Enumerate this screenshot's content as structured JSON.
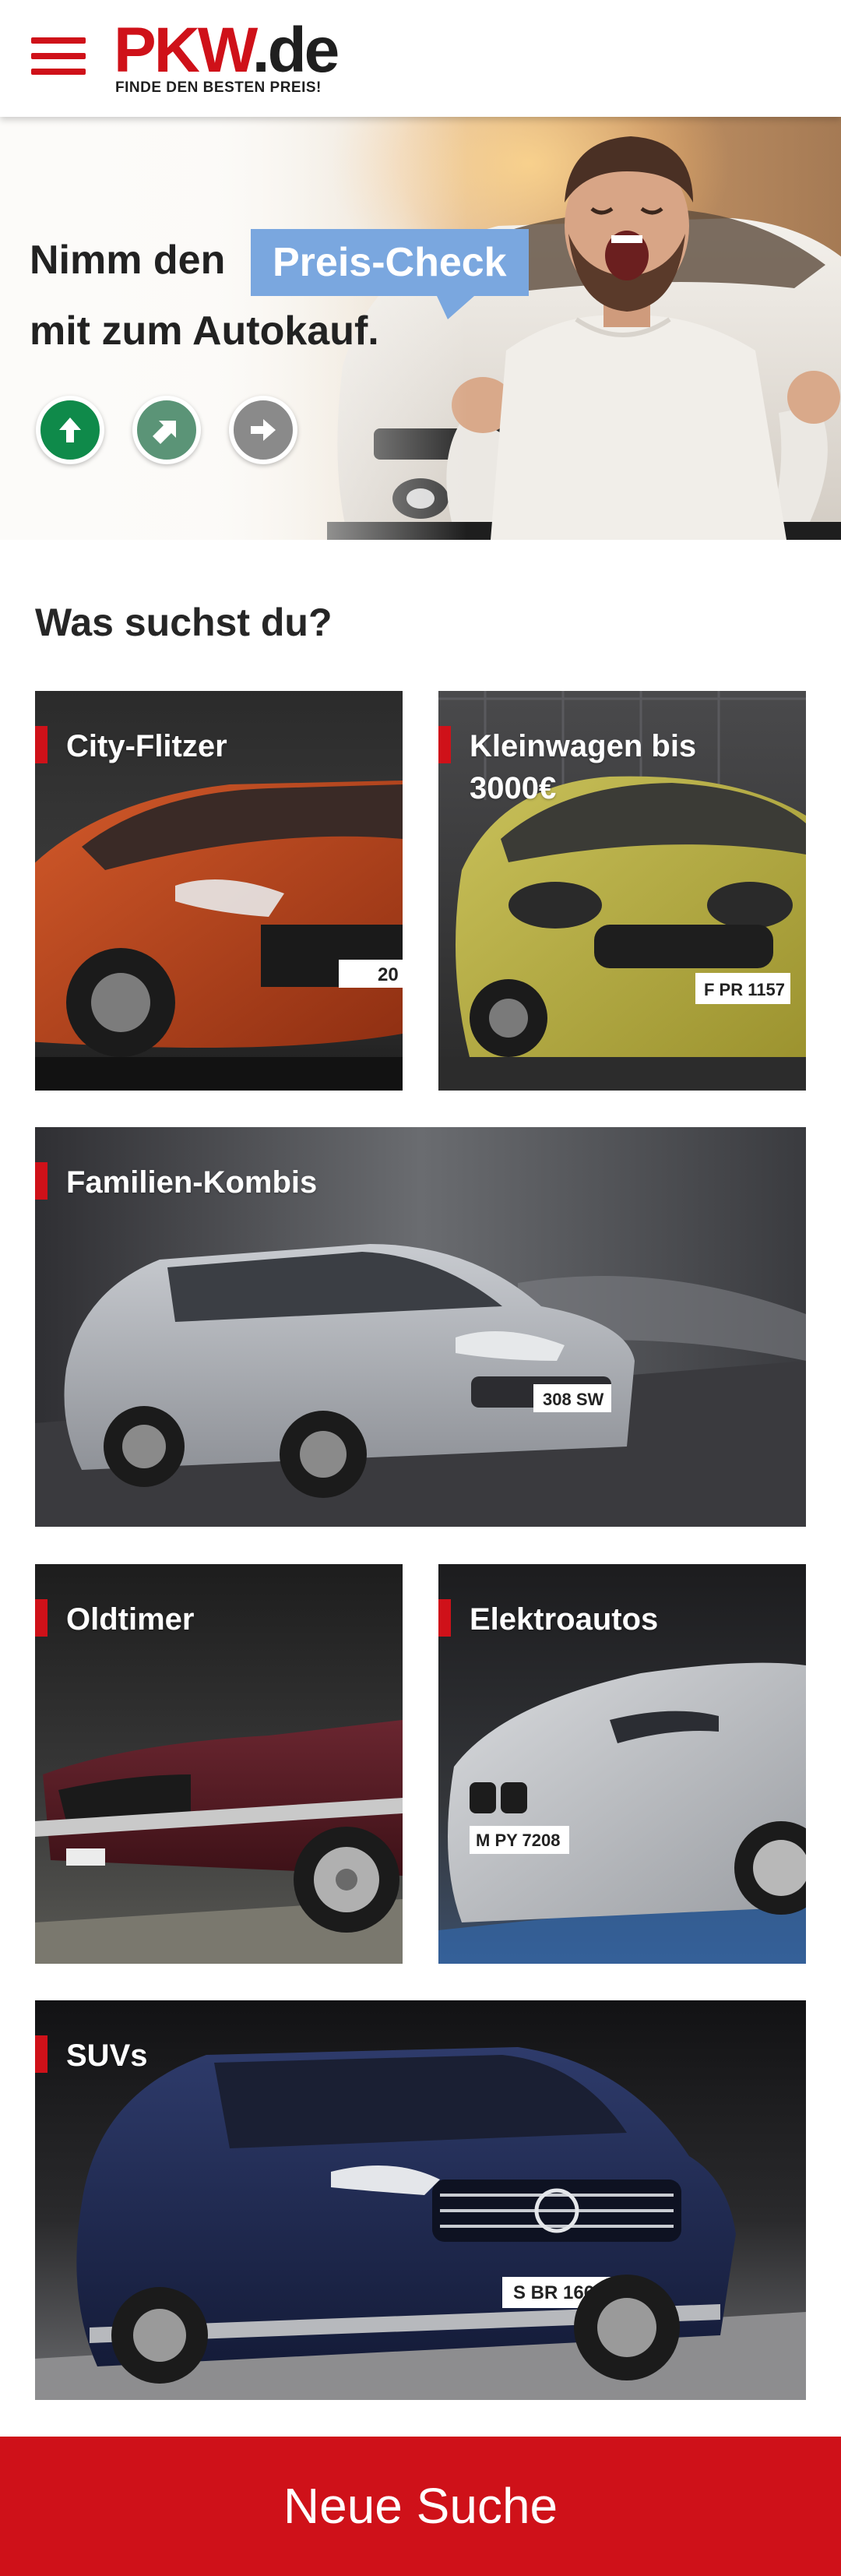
{
  "header": {
    "logo_main_red": "PKW",
    "logo_main_dark": ".de",
    "logo_tagline": "FINDE DEN BESTEN PREIS!"
  },
  "hero": {
    "line1": "Nimm den",
    "highlight": "Preis-Check",
    "line2": "mit zum Autokauf.",
    "buttons": [
      "arrow-up-icon",
      "arrow-up-right-icon",
      "arrow-right-icon"
    ]
  },
  "section": {
    "title": "Was suchst du?"
  },
  "categories": [
    {
      "label": "City-Flitzer"
    },
    {
      "label": "Kleinwagen bis 3000€"
    },
    {
      "label": "Familien-Kombis"
    },
    {
      "label": "Oldtimer"
    },
    {
      "label": "Elektroautos"
    },
    {
      "label": "SUVs"
    }
  ],
  "plates": {
    "city": "20",
    "klein": "F PR 1157",
    "kombi": "308 SW",
    "old": "",
    "elektro": "M PY 7208",
    "suv": "S BR 1660"
  },
  "cta": {
    "label": "Neue Suche"
  },
  "colors": {
    "brand_red": "#cf1119",
    "preis_check_blue": "#7aa7df",
    "btn_green": "#0f8a4a",
    "btn_green_light": "#5b9477",
    "btn_gray": "#8a8a8a"
  }
}
